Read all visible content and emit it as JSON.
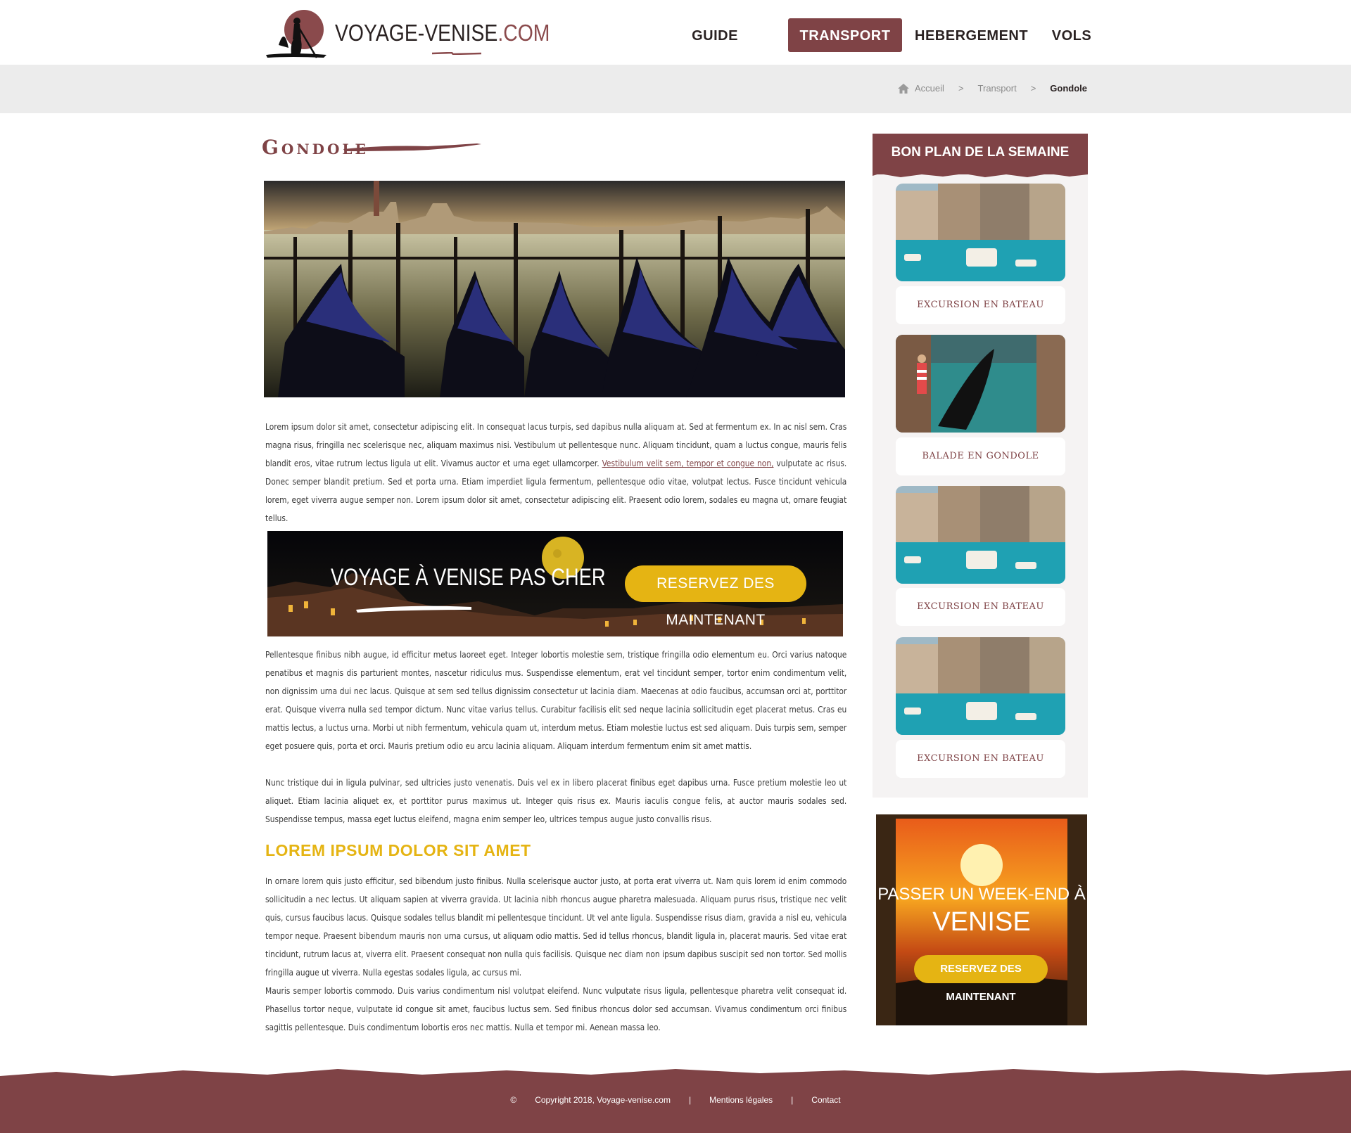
{
  "header": {
    "logo_text_main": "VOYAGE-VENISE",
    "logo_text_ext": ".COM",
    "nav": [
      {
        "label": "GUIDE TOURISTIQUE",
        "active": false
      },
      {
        "label": "TRANSPORT",
        "active": true
      },
      {
        "label": "HEBERGEMENT",
        "active": false
      },
      {
        "label": "VOLS",
        "active": false
      }
    ]
  },
  "breadcrumb": {
    "home": "Accueil",
    "sep": ">",
    "items": [
      "Transport",
      "Gondole"
    ]
  },
  "main": {
    "title": "Gondole",
    "paragraph1_a": "Lorem ipsum dolor sit amet, consectetur adipiscing elit. In consequat lacus turpis, sed dapibus nulla aliquam at. Sed at fermentum ex. In ac nisl sem. Cras magna risus, fringilla nec scelerisque nec, aliquam maximus nisi. Vestibulum ut pellentesque nunc. Aliquam tincidunt, quam a luctus congue, mauris felis blandit eros, vitae rutrum lectus ligula ut elit. Vivamus auctor et urna eget ullamcorper. ",
    "paragraph1_link": "Vestibulum velit sem, tempor et congue non,",
    "paragraph1_b": " vulputate ac risus. Donec semper blandit pretium. Sed et porta urna. Etiam imperdiet ligula fermentum, pellentesque odio vitae, volutpat lectus. Fusce tincidunt vehicula lorem, eget viverra augue semper non. Lorem ipsum dolor sit amet, consectetur adipiscing elit. Praesent odio lorem, sodales eu magna ut, ornare feugiat tellus.",
    "promo_title": "VOYAGE À VENISE PAS CHER",
    "promo_button": "RESERVEZ DES MAINTENANT",
    "paragraph2": " Pellentesque finibus nibh augue, id efficitur metus laoreet eget. Integer lobortis molestie sem, tristique fringilla odio elementum eu. Orci varius natoque penatibus et magnis dis parturient montes, nascetur ridiculus mus. Suspendisse elementum, erat vel tincidunt semper, tortor enim condimentum velit, non dignissim urna dui nec lacus. Quisque at sem sed tellus dignissim consectetur ut lacinia diam. Maecenas at odio faucibus, accumsan orci at, porttitor erat. Quisque viverra nulla sed tempor dictum. Nunc vitae varius tellus. Curabitur facilisis elit sed neque lacinia sollicitudin eget placerat metus. Cras eu mattis lectus, a luctus urna. Morbi ut nibh fermentum, vehicula quam ut, interdum metus. Etiam molestie luctus est sed aliquam. Duis turpis sem, semper eget posuere quis, porta et orci. Mauris pretium odio eu arcu lacinia aliquam. Aliquam interdum fermentum enim sit amet mattis.",
    "paragraph3": "Nunc tristique dui in ligula pulvinar, sed ultricies justo venenatis. Duis vel ex in libero placerat finibus eget dapibus urna. Fusce pretium molestie leo ut aliquet. Etiam lacinia aliquet ex, et porttitor purus maximus ut. Integer quis risus ex. Mauris iaculis congue felis, at auctor mauris sodales sed. Suspendisse tempus, massa eget luctus eleifend, magna enim semper leo, ultrices tempus augue justo convallis risus.",
    "section_heading": "LOREM IPSUM DOLOR SIT AMET",
    "paragraph4": "In ornare lorem quis justo efficitur, sed bibendum justo finibus. Nulla scelerisque auctor justo, at porta erat viverra ut. Nam quis lorem id enim commodo sollicitudin a nec lectus. Ut aliquam sapien at viverra gravida. Ut lacinia nibh rhoncus augue pharetra malesuada. Aliquam purus risus, tristique nec velit quis, cursus faucibus lacus. Quisque sodales tellus blandit mi pellentesque tincidunt. Ut vel ante ligula. Suspendisse risus diam, gravida a nisl eu, vehicula tempor neque. Praesent bibendum mauris non urna cursus, ut aliquam odio mattis. Sed id tellus rhoncus, blandit ligula in, placerat mauris. Sed vitae erat tincidunt, rutrum lacus at, viverra elit. Praesent consequat non nulla quis facilisis. Quisque nec diam non ipsum dapibus suscipit sed non tortor. Sed mollis fringilla augue ut viverra. Nulla egestas sodales ligula, ac cursus mi.",
    "paragraph5": " Mauris semper lobortis commodo. Duis varius condimentum nisl volutpat eleifend. Nunc vulputate risus ligula, pellentesque pharetra velit consequat id. Phasellus tortor neque, vulputate id congue sit amet, faucibus luctus sem. Sed finibus rhoncus dolor sed accumsan. Vivamus condimentum orci finibus sagittis pellentesque. Duis condimentum lobortis eros nec mattis. Nulla et tempor mi. Aenean massa leo."
  },
  "sidebar": {
    "heading": "BON PLAN DE LA SEMAINE",
    "cards": [
      {
        "label": "EXCURSION EN BATEAU",
        "image": "canal-boat"
      },
      {
        "label": "BALADE EN GONDOLE",
        "image": "gondola-ride"
      },
      {
        "label": "EXCURSION EN BATEAU",
        "image": "canal-boat"
      },
      {
        "label": "EXCURSION EN BATEAU",
        "image": "canal-boat"
      }
    ],
    "weekend_line1": "PASSER UN WEEK-END À",
    "weekend_line2": "VENISE",
    "weekend_button": "RESERVEZ DES MAINTENANT"
  },
  "footer": {
    "copyright_icon": "©",
    "copyright": "Copyright 2018, Voyage-venise.com",
    "separator": "|",
    "links": [
      "Mentions légales",
      "Contact"
    ]
  },
  "colors": {
    "brand": "#7f4346",
    "accent": "#e5b413",
    "breadcrumb_bg": "#ececec",
    "sidebar_bg": "#f5f3f3"
  }
}
